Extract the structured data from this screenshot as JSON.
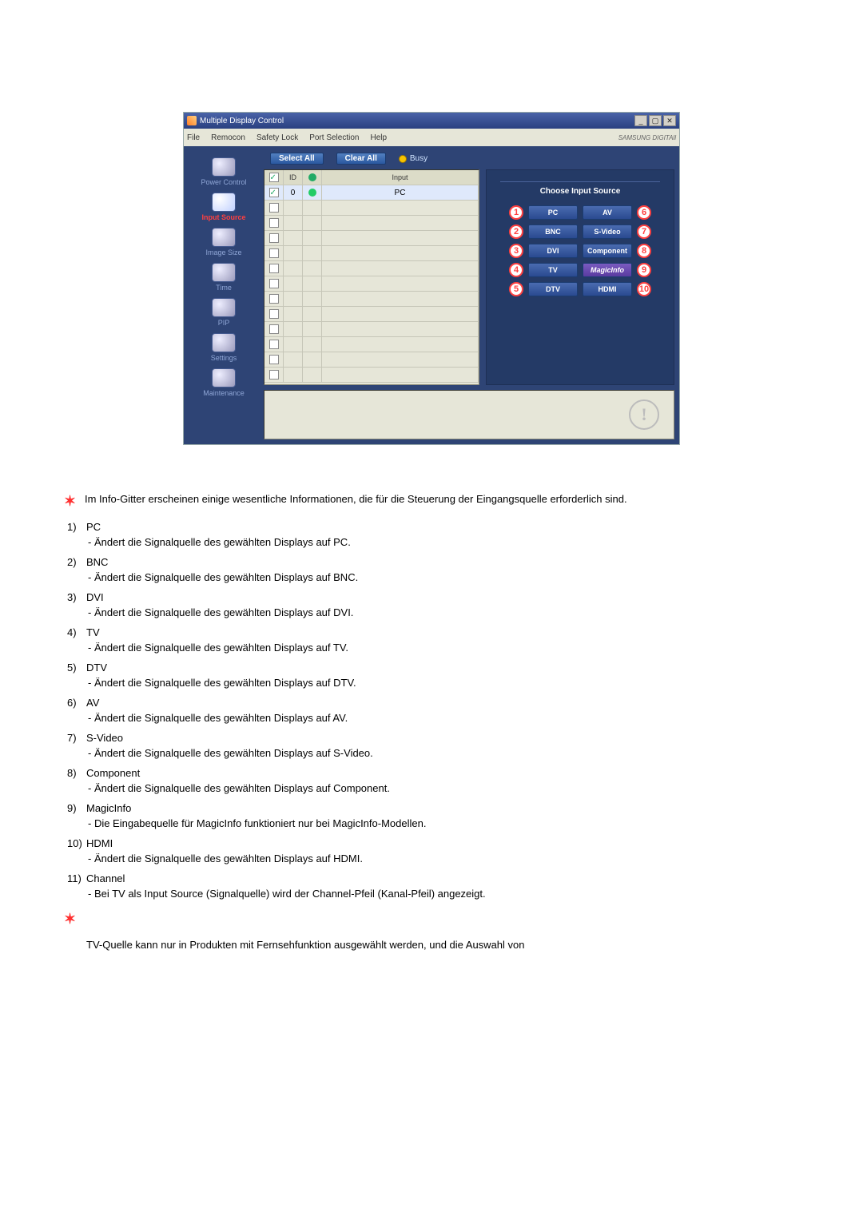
{
  "app": {
    "title": "Multiple Display Control",
    "menu": [
      "File",
      "Remocon",
      "Safety Lock",
      "Port Selection",
      "Help"
    ],
    "brand": "SAMSUNG DIGITAll"
  },
  "sidebar": {
    "items": [
      {
        "label": "Power Control"
      },
      {
        "label": "Input Source"
      },
      {
        "label": "Image Size"
      },
      {
        "label": "Time"
      },
      {
        "label": "PIP"
      },
      {
        "label": "Settings"
      },
      {
        "label": "Maintenance"
      }
    ]
  },
  "toolbar": {
    "select_all": "Select All",
    "clear_all": "Clear All",
    "busy": "Busy"
  },
  "grid": {
    "headers": {
      "id": "ID",
      "input": "Input"
    },
    "row0": {
      "id": "0",
      "input": "PC"
    }
  },
  "panel": {
    "title": "Choose Input Source",
    "sources": {
      "s1": "PC",
      "s6": "AV",
      "s2": "BNC",
      "s7": "S-Video",
      "s3": "DVI",
      "s8": "Component",
      "s4": "TV",
      "s9": "MagicInfo",
      "s5": "DTV",
      "s10": "HDMI"
    },
    "nums": {
      "n1": "1",
      "n2": "2",
      "n3": "3",
      "n4": "4",
      "n5": "5",
      "n6": "6",
      "n7": "7",
      "n8": "8",
      "n9": "9",
      "n10": "10"
    }
  },
  "notes": {
    "intro": "Im Info-Gitter erscheinen einige wesentliche Informationen, die für die Steuerung der Eingangsquelle erforderlich sind.",
    "items": [
      {
        "num": "1)",
        "title": "PC",
        "desc": "- Ändert die Signalquelle des gewählten Displays auf PC."
      },
      {
        "num": "2)",
        "title": "BNC",
        "desc": "- Ändert die Signalquelle des gewählten Displays auf BNC."
      },
      {
        "num": "3)",
        "title": "DVI",
        "desc": "- Ändert die Signalquelle des gewählten Displays auf DVI."
      },
      {
        "num": "4)",
        "title": "TV",
        "desc": "- Ändert die Signalquelle des gewählten Displays auf TV."
      },
      {
        "num": "5)",
        "title": "DTV",
        "desc": "- Ändert die Signalquelle des gewählten Displays auf DTV."
      },
      {
        "num": "6)",
        "title": "AV",
        "desc": "- Ändert die Signalquelle des gewählten Displays auf AV."
      },
      {
        "num": "7)",
        "title": "S-Video",
        "desc": "- Ändert die Signalquelle des gewählten Displays auf S-Video."
      },
      {
        "num": "8)",
        "title": "Component",
        "desc": "- Ändert die Signalquelle des gewählten Displays auf Component."
      },
      {
        "num": "9)",
        "title": "MagicInfo",
        "desc": "- Die Eingabequelle für MagicInfo funktioniert nur bei MagicInfo-Modellen."
      },
      {
        "num": "10)",
        "title": "HDMI",
        "desc": "- Ändert die Signalquelle des gewählten Displays auf HDMI."
      },
      {
        "num": "11)",
        "title": "Channel",
        "desc": "- Bei TV als Input Source (Signalquelle) wird der Channel-Pfeil (Kanal-Pfeil) angezeigt."
      }
    ],
    "trailing": "TV-Quelle kann nur in Produkten mit Fernsehfunktion ausgewählt werden, und die Auswahl von"
  }
}
